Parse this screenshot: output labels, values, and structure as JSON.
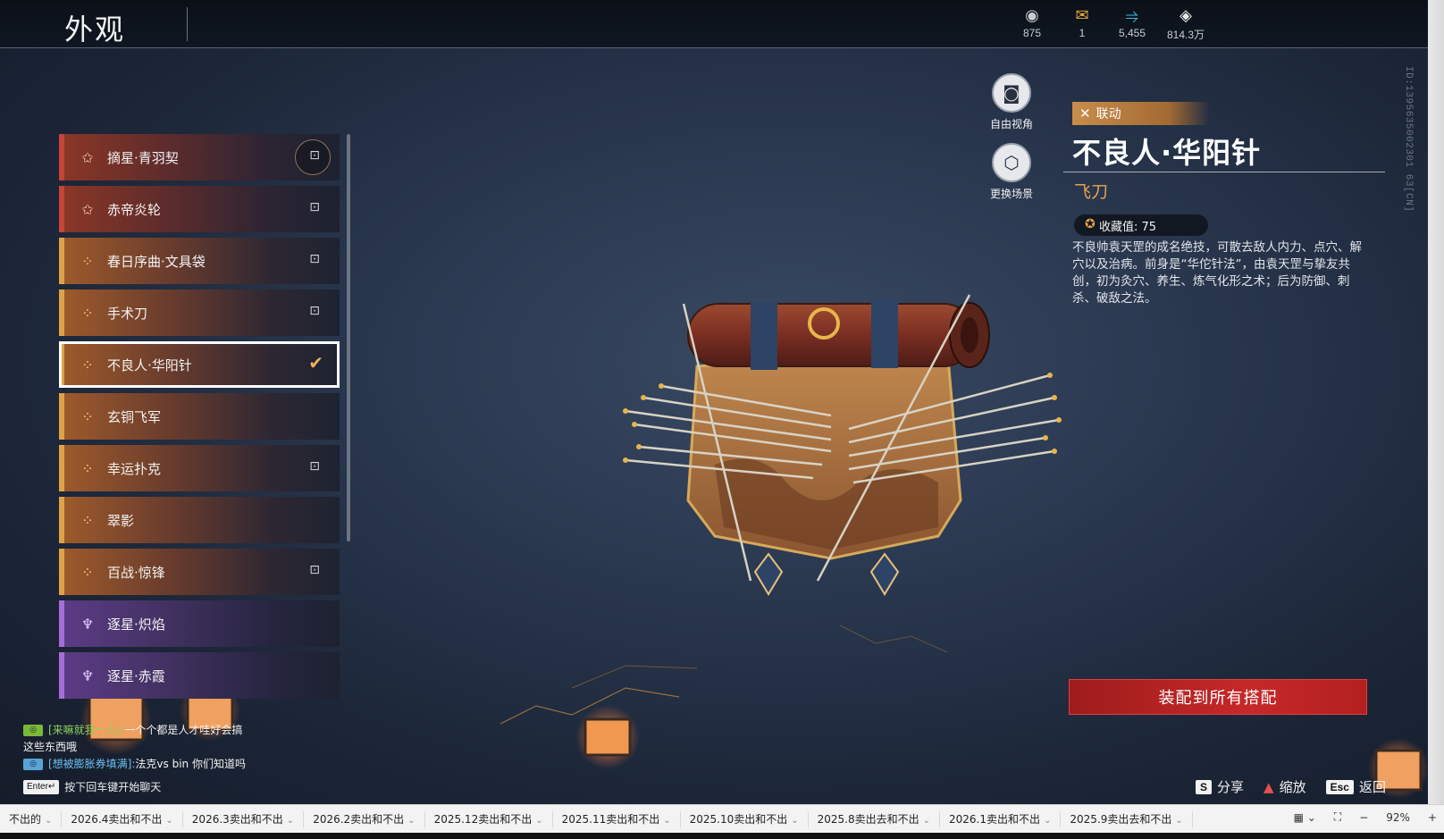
{
  "header": {
    "title": "外观"
  },
  "currencies": [
    {
      "icon": "coin-icon",
      "glyph": "◉",
      "color": "#c8ccd2",
      "amount": "875"
    },
    {
      "icon": "ticket-icon",
      "glyph": "✉",
      "color": "#e9b13c",
      "amount": "1"
    },
    {
      "icon": "feather-icon",
      "glyph": "⥤",
      "color": "#3fbde0",
      "amount": "5,455"
    },
    {
      "icon": "diamond-icon",
      "glyph": "◈",
      "color": "#e8e8e8",
      "amount": "814.3万"
    }
  ],
  "uid": "ID:1395635002301 63[CN]",
  "skins": [
    {
      "name": "摘星·青羽契",
      "rarity": "red",
      "glyph": "✩",
      "locked": true,
      "lock_ring": true
    },
    {
      "name": "赤帝炎轮",
      "rarity": "red",
      "glyph": "✩",
      "locked": true
    },
    {
      "name": "春日序曲·文具袋",
      "rarity": "gold",
      "glyph": "⁘",
      "locked": true
    },
    {
      "name": "手术刀",
      "rarity": "gold",
      "glyph": "⁘",
      "locked": true
    },
    {
      "name": "不良人·华阳针",
      "rarity": "gold",
      "glyph": "⁘",
      "locked": false,
      "selected": true
    },
    {
      "name": "玄铜飞军",
      "rarity": "gold",
      "glyph": "⁘",
      "locked": false
    },
    {
      "name": "幸运扑克",
      "rarity": "gold",
      "glyph": "⁘",
      "locked": true
    },
    {
      "name": "翠影",
      "rarity": "gold",
      "glyph": "⁘",
      "locked": false
    },
    {
      "name": "百战·惊锋",
      "rarity": "gold",
      "glyph": "⁘",
      "locked": true
    },
    {
      "name": "逐星·炽焰",
      "rarity": "purple",
      "glyph": "♆",
      "locked": false
    },
    {
      "name": "逐星·赤霞",
      "rarity": "purple",
      "glyph": "♆",
      "locked": false
    }
  ],
  "side_controls": {
    "free_view": "自由视角",
    "change_scene": "更换场景"
  },
  "detail": {
    "badge": "联动",
    "name": "不良人·华阳针",
    "type": "飞刀",
    "collect_label": "收藏值: 75",
    "description": "不良帅袁天罡的成名绝技，可散去敌人内力、点穴、解穴以及治病。前身是“华佗针法”，由袁天罡与挚友共创，初为灸穴、养生、炼气化形之术；后为防御、刺杀、破敌之法。",
    "equip_button": "装配到所有搭配"
  },
  "chat": {
    "line1_channel": "[来嘛就我一人]:",
    "line1_text": "一个个都是人才哇好会搞",
    "line2_text": "这些东西哦",
    "line3_channel": "[想被膨胀券填满]:",
    "line3_text": "法克vs bin 你们知道吗",
    "enter_key": "Enter↵",
    "enter_hint": "按下回车键开始聊天"
  },
  "hints": [
    {
      "key": "S",
      "label": "分享"
    },
    {
      "key": "▲",
      "label": "缩放",
      "icon": true
    },
    {
      "key": "Esc",
      "label": "返回"
    }
  ],
  "taskbar": {
    "tabs": [
      "不出的",
      "2026.4卖出和不出",
      "2026.3卖出和不出",
      "2026.2卖出和不出",
      "2025.12卖出和不出",
      "2025.11卖出和不出",
      "2025.10卖出和不出",
      "2025.8卖出去和不出",
      "2026.1卖出和不出",
      "2025.9卖出去和不出"
    ],
    "zoom": "92%"
  }
}
